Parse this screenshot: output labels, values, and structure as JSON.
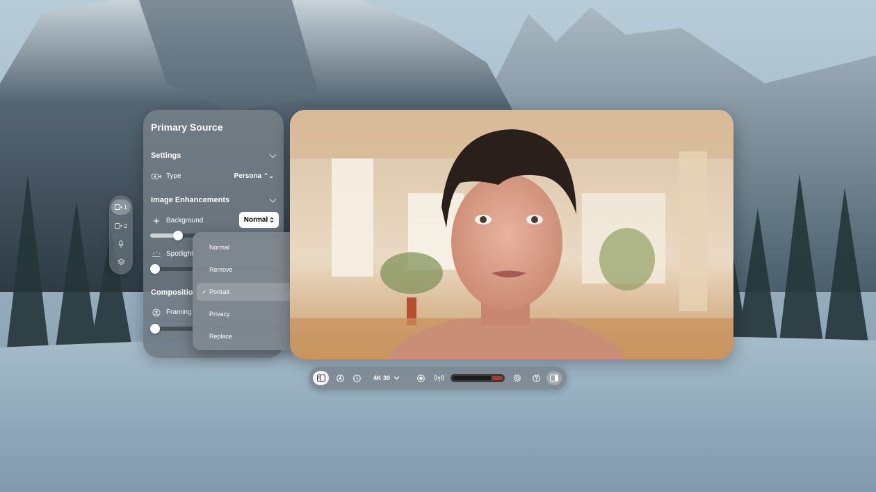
{
  "rail": {
    "items": [
      {
        "icon": "camera-icon",
        "label": "1",
        "active": true
      },
      {
        "icon": "camera-icon",
        "label": "2",
        "active": false
      },
      {
        "icon": "microphone-icon",
        "label": "",
        "active": false
      },
      {
        "icon": "layers-icon",
        "label": "",
        "active": false
      }
    ]
  },
  "panel": {
    "title": "Primary Source",
    "settings": {
      "heading": "Settings",
      "type_label": "Type",
      "type_value": "Persona"
    },
    "image_enhancements": {
      "heading": "Image Enhancements",
      "background_label": "Background",
      "background_value": "Normal",
      "background_slider": 0.19,
      "spotlight_label": "Spotlight",
      "spotlight_slider": 0.0
    },
    "composition": {
      "heading": "Composition",
      "framing_label": "Framing",
      "framing_slider": 0.0
    }
  },
  "menu": {
    "options": [
      "Normal",
      "Remove",
      "Portrait",
      "Privacy",
      "Replace"
    ],
    "selected": "Portrait",
    "check": "✓"
  },
  "toolbar": {
    "resolution": "4K 30",
    "audio_level": 0.78
  },
  "colors": {
    "meter_peak": "#a0402c",
    "accent_white": "#ffffff"
  }
}
